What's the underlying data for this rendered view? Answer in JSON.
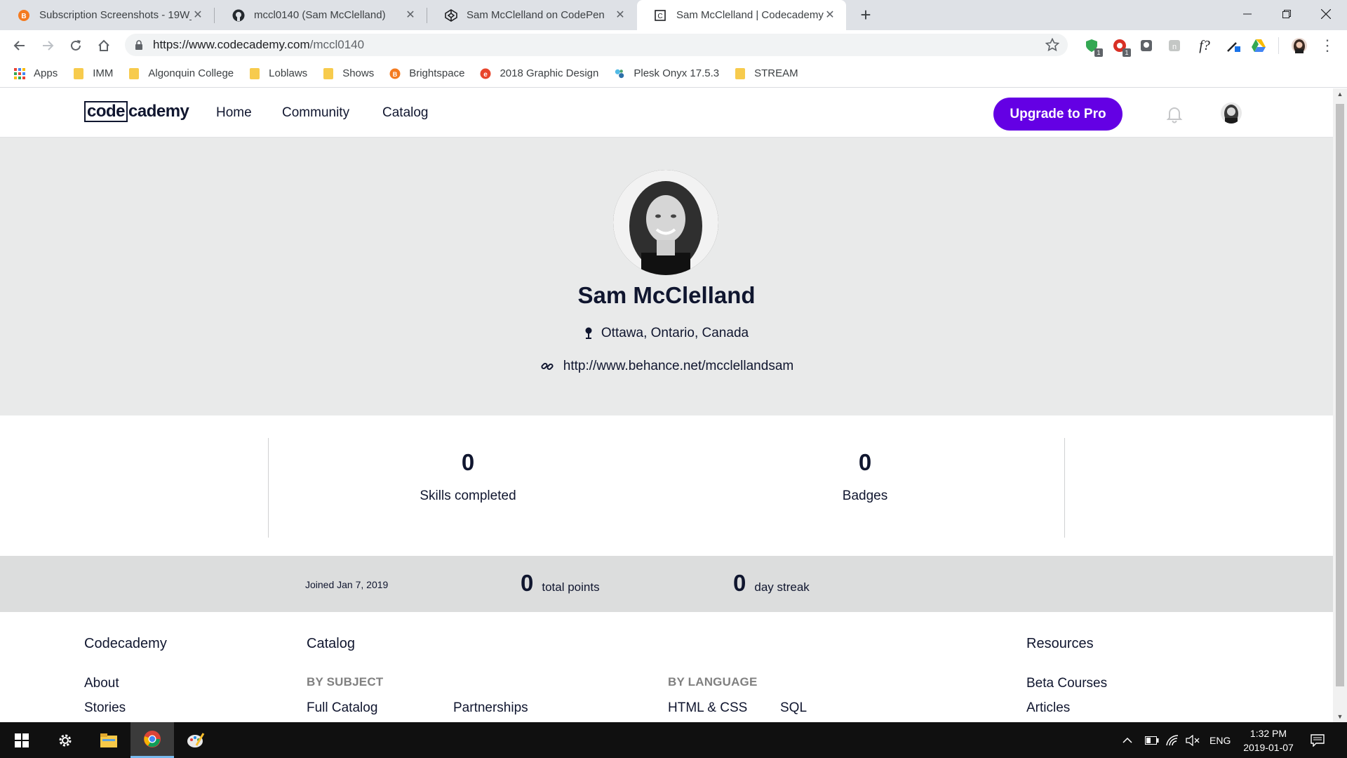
{
  "browser": {
    "tabs": [
      {
        "title": "Subscription Screenshots - 19W_",
        "active": false
      },
      {
        "title": "mccl0140 (Sam McClelland)",
        "active": false
      },
      {
        "title": "Sam McClelland on CodePen",
        "active": false
      },
      {
        "title": "Sam McClelland | Codecademy",
        "active": true
      }
    ],
    "url_host": "https://www.codecademy.com",
    "url_path": "/mccl0140",
    "extension_badges": [
      "1",
      "1"
    ],
    "bookmarks": [
      {
        "label": "Apps",
        "icon": "apps-grid-icon"
      },
      {
        "label": "IMM",
        "icon": "folder-icon"
      },
      {
        "label": "Algonquin College",
        "icon": "folder-icon"
      },
      {
        "label": "Loblaws",
        "icon": "folder-icon"
      },
      {
        "label": "Shows",
        "icon": "folder-icon"
      },
      {
        "label": "Brightspace",
        "icon": "brightspace-icon"
      },
      {
        "label": "2018 Graphic Design",
        "icon": "e-logo-icon"
      },
      {
        "label": "Plesk Onyx 17.5.3",
        "icon": "plesk-icon"
      },
      {
        "label": "STREAM",
        "icon": "folder-icon"
      }
    ],
    "ext_f_label": "f?"
  },
  "site": {
    "logo_boxed": "code",
    "logo_rest": "cademy",
    "nav": [
      "Home",
      "Community",
      "Catalog"
    ],
    "upgrade_label": "Upgrade to Pro"
  },
  "profile": {
    "name": "Sam McClelland",
    "location": "Ottawa, Ontario, Canada",
    "website": "http://www.behance.net/mcclellandsam"
  },
  "stats": {
    "skills_value": "0",
    "skills_label": "Skills completed",
    "badges_value": "0",
    "badges_label": "Badges"
  },
  "points": {
    "joined": "Joined Jan 7, 2019",
    "total_value": "0",
    "total_label": "total points",
    "streak_value": "0",
    "streak_label": "day streak"
  },
  "footer": {
    "col1_head": "Codecademy",
    "col1_links": [
      "About",
      "Stories"
    ],
    "col2_head": "Catalog",
    "by_subject": "BY SUBJECT",
    "subject_links": [
      "Full Catalog",
      "Partnerships"
    ],
    "by_language": "BY LANGUAGE",
    "language_links": [
      "HTML & CSS",
      "SQL"
    ],
    "col4_head": "Resources",
    "resource_links": [
      "Beta Courses",
      "Articles"
    ]
  },
  "taskbar": {
    "lang": "ENG",
    "time": "1:32 PM",
    "date": "2019-01-07"
  },
  "colors": {
    "brand_purple": "#6400e4",
    "navy_text": "#10162f",
    "hero_bg": "#e9eaea"
  }
}
